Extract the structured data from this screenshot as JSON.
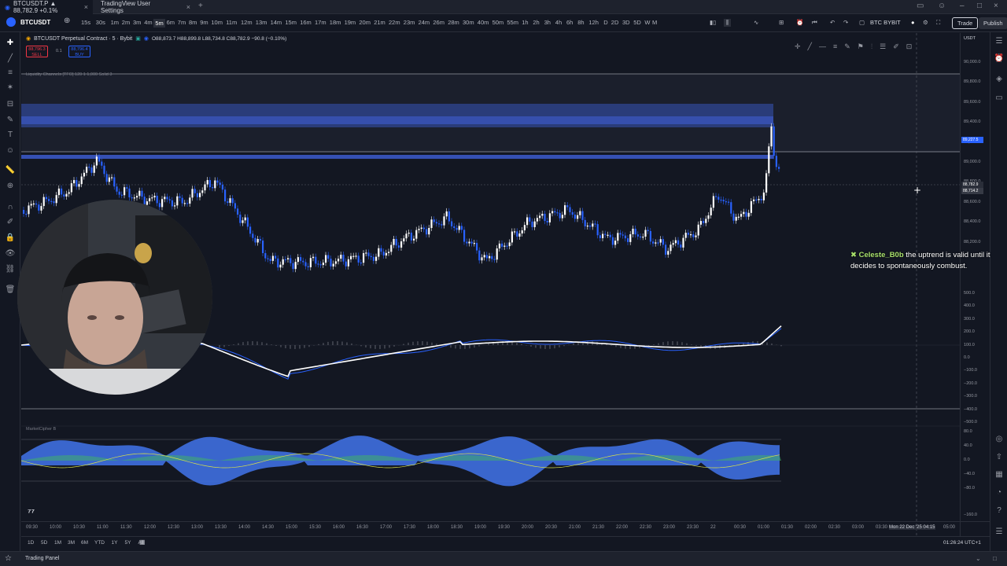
{
  "tabs": [
    {
      "label": "BTCUSDT.P ▲ 88,782.9 +0.1%",
      "active": true
    },
    {
      "label": "TradingView User Settings",
      "active": false
    }
  ],
  "toolbar": {
    "symbol": "BTCUSDT",
    "timeframes": [
      "15s",
      "30s",
      "1m",
      "2m",
      "3m",
      "4m",
      "5m",
      "6m",
      "7m",
      "8m",
      "9m",
      "10m",
      "11m",
      "12m",
      "13m",
      "14m",
      "15m",
      "16m",
      "17m",
      "18m",
      "19m",
      "20m",
      "21m",
      "22m",
      "23m",
      "24m",
      "26m",
      "28m",
      "30m",
      "40m",
      "50m",
      "55m",
      "1h",
      "2h",
      "3h",
      "4h",
      "6h",
      "8h",
      "12h",
      "D",
      "2D",
      "3D",
      "5D",
      "W",
      "M"
    ],
    "selected_timeframe": "5m",
    "account": "BTC BYBIT",
    "trade_label": "Trade",
    "publish_label": "Publish"
  },
  "legend": {
    "title": "BTCUSDT Perpetual Contract · 5 · Bybit",
    "ohlc": "O88,873.7 H88,899.8 L88,734.8 C88,782.9 −90.8 (−0.10%)",
    "sell_price": "88,796.3",
    "sell_label": "SELL",
    "spread": "0.1",
    "buy_price": "88,796.4",
    "buy_label": "BUY",
    "indicator_line": "Liquidity Channels [TFO] 120 1 1,000 Solid 3",
    "oscillator_label": "MarketCipher B"
  },
  "price_axis": {
    "main": [
      "90,000.0",
      "89,800.0",
      "89,600.0",
      "89,400.0",
      "89,200.0",
      "89,000.0",
      "88,800.0",
      "88,600.0",
      "88,400.0",
      "88,200.0"
    ],
    "macd": [
      "500.0",
      "400.0",
      "300.0",
      "200.0",
      "100.0",
      "0.0",
      "−100.0",
      "−200.0",
      "−300.0",
      "−400.0",
      "−500.0"
    ],
    "osc": [
      "80.0",
      "40.0",
      "0.0",
      "−40.0",
      "−80.0",
      "−160.0"
    ],
    "badge_blue": "89,227.5",
    "badge_last": "88,782.9",
    "badge_cross": "88,714.2",
    "currency": "USDT"
  },
  "time_axis": [
    "09:30",
    "10:00",
    "10:30",
    "11:00",
    "11:30",
    "12:00",
    "12:30",
    "13:00",
    "13:30",
    "14:00",
    "14:30",
    "15:00",
    "15:30",
    "16:00",
    "16:30",
    "17:00",
    "17:30",
    "18:00",
    "18:30",
    "19:00",
    "19:30",
    "20:00",
    "20:30",
    "21:00",
    "21:30",
    "22:00",
    "22:30",
    "23:00",
    "23:30",
    "22",
    "00:30",
    "01:00",
    "01:30",
    "02:00",
    "02:30",
    "03:00",
    "03:30",
    "Mon 22 Dec '25 04:15",
    "05:00"
  ],
  "bottom_bar": {
    "ranges": [
      "1D",
      "5D",
      "1M",
      "3M",
      "6M",
      "YTD",
      "1Y",
      "5Y",
      "All"
    ],
    "clock": "01:26:24 UTC+1"
  },
  "panel": {
    "label": "Trading Panel"
  },
  "chat": {
    "user": "Celeste_B0b",
    "message": "the uptrend is valid until it decides to spontaneously combust."
  },
  "colors": {
    "bg": "#131722",
    "up": "#ffffff",
    "down": "#2962ff",
    "channel": "#3f5fd8",
    "macd": "#ffffff",
    "accent": "#2962ff"
  }
}
